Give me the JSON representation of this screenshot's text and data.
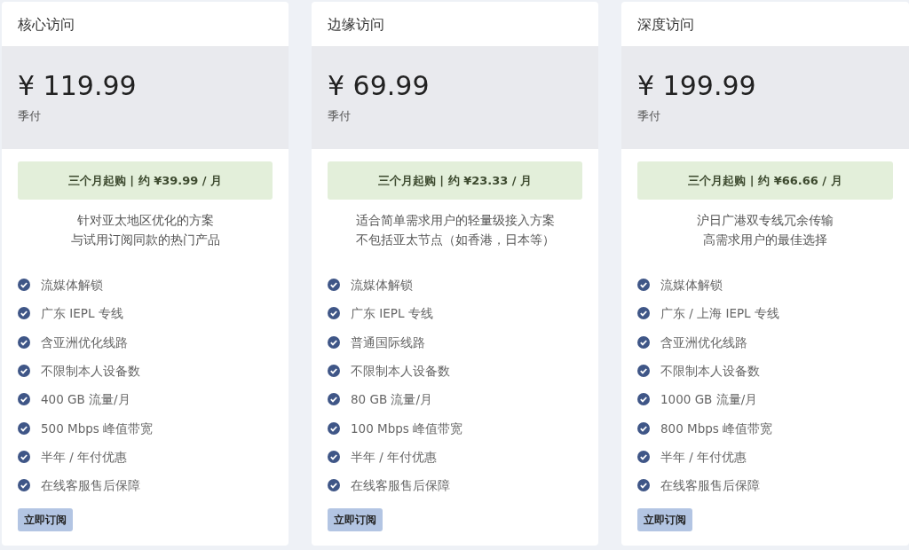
{
  "plans": [
    {
      "name": "核心访问",
      "price": "¥ 119.99",
      "period": "季付",
      "promo": "三个月起购 | 约 ¥39.99 / 月",
      "description": [
        "针对亚太地区优化的方案",
        "与试用订阅同款的热门产品"
      ],
      "features": [
        "流媒体解锁",
        "广东 IEPL 专线",
        "含亚洲优化线路",
        "不限制本人设备数",
        "400 GB 流量/月",
        "500 Mbps 峰值带宽",
        "半年 / 年付优惠",
        "在线客服售后保障"
      ],
      "button": "立即订阅"
    },
    {
      "name": "边缘访问",
      "price": "¥ 69.99",
      "period": "季付",
      "promo": "三个月起购 | 约 ¥23.33 / 月",
      "description": [
        "适合简单需求用户的轻量级接入方案",
        "不包括亚太节点（如香港，日本等）"
      ],
      "features": [
        "流媒体解锁",
        "广东 IEPL 专线",
        "普通国际线路",
        "不限制本人设备数",
        "80 GB 流量/月",
        "100 Mbps 峰值带宽",
        "半年 / 年付优惠",
        "在线客服售后保障"
      ],
      "button": "立即订阅"
    },
    {
      "name": "深度访问",
      "price": "¥ 199.99",
      "period": "季付",
      "promo": "三个月起购 | 约 ¥66.66 / 月",
      "description": [
        "沪日广港双专线冗余传输",
        "高需求用户的最佳选择"
      ],
      "features": [
        "流媒体解锁",
        "广东 / 上海 IEPL 专线",
        "含亚洲优化线路",
        "不限制本人设备数",
        "1000 GB 流量/月",
        "800 Mbps 峰值带宽",
        "半年 / 年付优惠",
        "在线客服售后保障"
      ],
      "button": "立即订阅"
    }
  ]
}
